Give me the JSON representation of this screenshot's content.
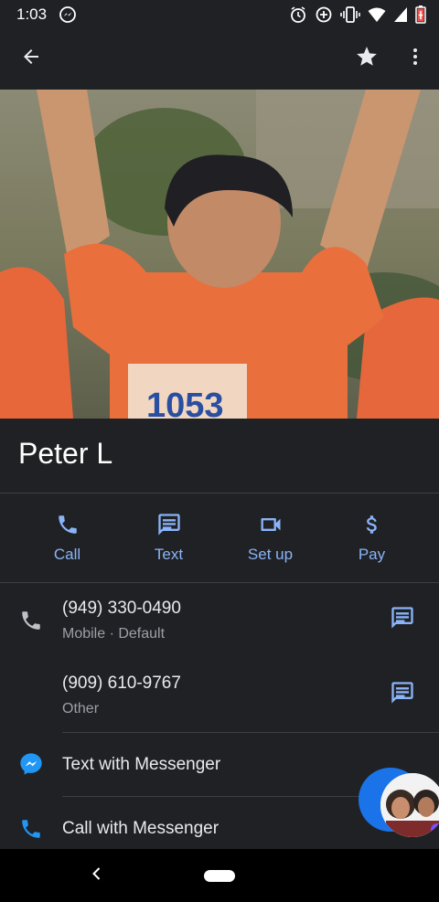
{
  "status_bar": {
    "time": "1:03",
    "left_icons": [
      "messenger-icon"
    ],
    "right_icons": [
      "alarm-icon",
      "data-saver-icon",
      "vibrate-icon",
      "wifi-icon",
      "signal-icon",
      "battery-icon"
    ]
  },
  "app_bar": {
    "back_icon": "arrow-back-icon",
    "star_icon": "star-icon",
    "more_icon": "more-vert-icon"
  },
  "contact": {
    "name": "Peter L"
  },
  "actions": [
    {
      "label": "Call",
      "icon": "phone-icon"
    },
    {
      "label": "Text",
      "icon": "message-icon"
    },
    {
      "label": "Set up",
      "icon": "videocam-icon"
    },
    {
      "label": "Pay",
      "icon": "dollar-icon"
    }
  ],
  "phones": [
    {
      "number": "(949) 330-0490",
      "type": "Mobile · Default"
    },
    {
      "number": "(909) 610-9767",
      "type": "Other"
    }
  ],
  "messenger": {
    "text_label": "Text with Messenger",
    "call_label": "Call with Messenger"
  },
  "colors": {
    "background": "#202124",
    "accent": "#8ab4f8",
    "messenger_blue": "#1a73e8",
    "divider": "#3c4043"
  }
}
